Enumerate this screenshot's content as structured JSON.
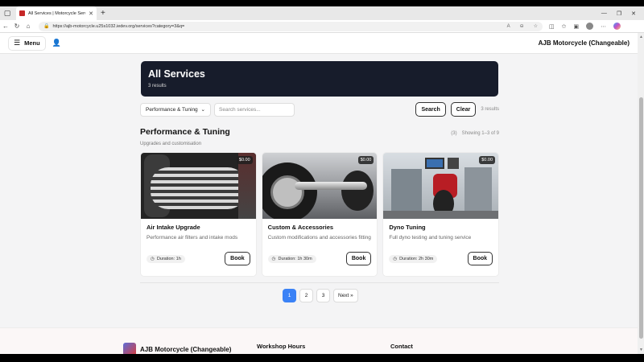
{
  "browser": {
    "tab_title": "All Services | Motorcycle Services",
    "url": "https://ajb-motorcycle.u25s1032.iedev.org/services?category=3&q="
  },
  "header": {
    "menu_label": "Menu",
    "brand": "AJB Motorcycle (Changeable)"
  },
  "hero": {
    "title": "All Services",
    "subtitle": "3 results"
  },
  "filters": {
    "category_selected": "Performance & Tuning",
    "search_placeholder": "Search services...",
    "search_label": "Search",
    "clear_label": "Clear",
    "results_count": "3 results"
  },
  "section": {
    "title": "Performance & Tuning",
    "count": "(3)",
    "showing": "Showing 1–3 of 9",
    "description": "Upgrades and customisation"
  },
  "services": [
    {
      "title": "Air Intake Upgrade",
      "description": "Performance air filters and intake mods",
      "price": "$0.00",
      "duration": "Duration: 1h",
      "book_label": "Book"
    },
    {
      "title": "Custom & Accessories",
      "description": "Custom modifications and accessories fitting",
      "price": "$0.00",
      "duration": "Duration: 1h 30m",
      "book_label": "Book"
    },
    {
      "title": "Dyno Tuning",
      "description": "Full dyno testing and tuning service",
      "price": "$0.00",
      "duration": "Duration: 2h 30m",
      "book_label": "Book"
    }
  ],
  "pagination": {
    "pages": [
      "1",
      "2",
      "3"
    ],
    "current": "1",
    "next_label": "Next »"
  },
  "footer": {
    "brand": "AJB Motorcycle (Changeable)",
    "col_hours": "Workshop Hours",
    "col_contact": "Contact"
  },
  "colors": {
    "hero_bg": "#171c2b",
    "accent": "#3b82f6"
  },
  "icons": {
    "menu": "hamburger-icon",
    "user": "user-icon",
    "duration": "clock-icon"
  }
}
